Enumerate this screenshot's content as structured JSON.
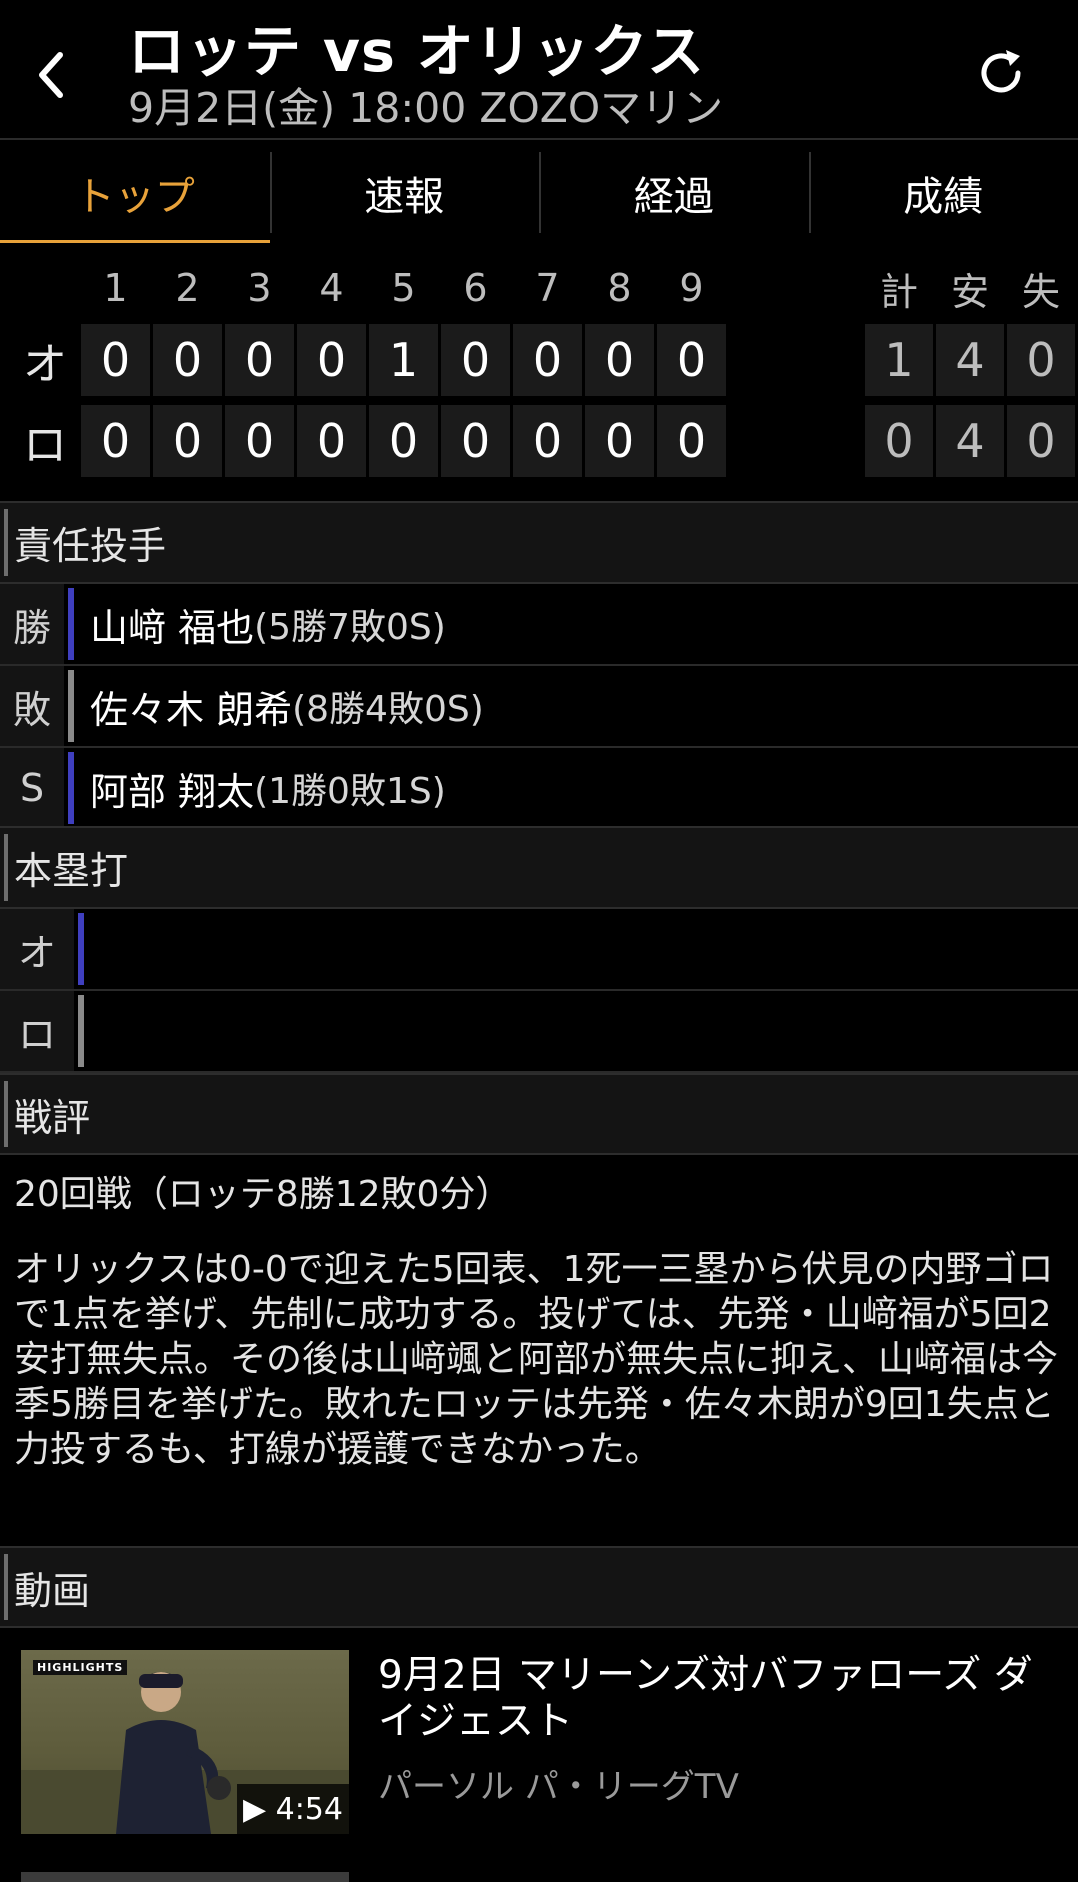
{
  "header": {
    "title": "ロッテ vs オリックス",
    "subtitle": "9月2日(金) 18:00 ZOZOマリン",
    "back_icon": "chevron-left-icon",
    "reload_icon": "reload-icon"
  },
  "tabs": [
    {
      "label": "トップ",
      "active": true
    },
    {
      "label": "速報",
      "active": false
    },
    {
      "label": "経過",
      "active": false
    },
    {
      "label": "成績",
      "active": false
    }
  ],
  "scoreboard": {
    "innings": [
      "1",
      "2",
      "3",
      "4",
      "5",
      "6",
      "7",
      "8",
      "9"
    ],
    "total_headers": [
      "計",
      "安",
      "失"
    ],
    "teams": [
      {
        "label": "オ",
        "scores": [
          "0",
          "0",
          "0",
          "0",
          "1",
          "0",
          "0",
          "0",
          "0"
        ],
        "totals": [
          "1",
          "4",
          "0"
        ]
      },
      {
        "label": "ロ",
        "scores": [
          "0",
          "0",
          "0",
          "0",
          "0",
          "0",
          "0",
          "0",
          "0"
        ],
        "totals": [
          "0",
          "4",
          "0"
        ]
      }
    ]
  },
  "pitchers": {
    "heading": "責任投手",
    "rows": [
      {
        "label": "勝",
        "name": "山﨑 福也",
        "record": "(5勝7敗0S)",
        "bar_color": "#3f3fbf"
      },
      {
        "label": "敗",
        "name": "佐々木 朗希",
        "record": "(8勝4敗0S)",
        "bar_color": "#8a8a8a"
      },
      {
        "label": "S",
        "name": "阿部 翔太",
        "record": "(1勝0敗1S)",
        "bar_color": "#3f3fbf"
      }
    ]
  },
  "homeruns": {
    "heading": "本塁打",
    "rows": [
      {
        "label": "オ",
        "bar_color": "#3f3fbf"
      },
      {
        "label": "ロ",
        "bar_color": "#8a8a8a"
      }
    ]
  },
  "review": {
    "heading": "戦評",
    "summary": "20回戦（ロッテ8勝12敗0分）",
    "body": "オリックスは0-0で迎えた5回表、1死一三塁から伏見の内野ゴロで1点を挙げ、先制に成功する。投げては、先発・山﨑福が5回2安打無失点。その後は山﨑颯と阿部が無失点に抑え、山﨑福は今季5勝目を挙げた。敗れたロッテは先発・佐々木朗が9回1失点と力投するも、打線が援護できなかった。"
  },
  "video": {
    "heading": "動画",
    "badge": "HIGHLIGHTS",
    "duration": "▶ 4:54",
    "title": "9月2日 マリーンズ対バファローズ ダイジェスト",
    "source": "パーソル パ・リーグTV"
  }
}
